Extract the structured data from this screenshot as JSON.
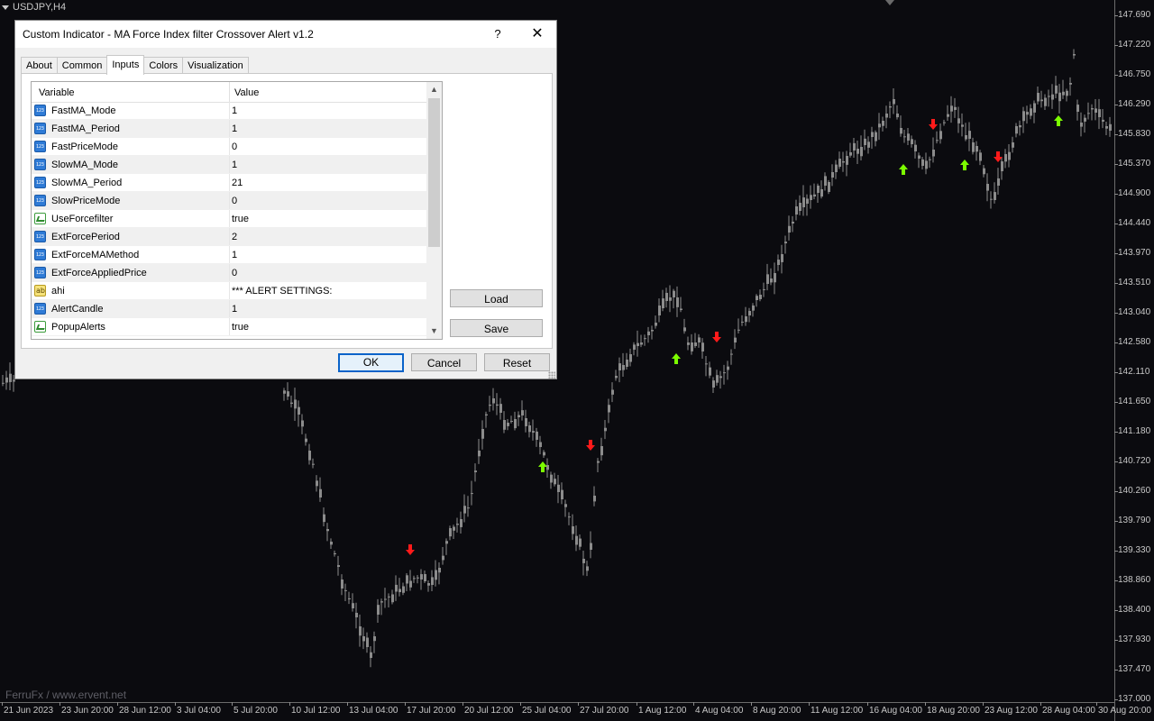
{
  "chart": {
    "symbol": "USDJPY,H4",
    "watermark": "FerruFx / www.ervent.net",
    "price_labels": [
      "147.690",
      "147.220",
      "146.750",
      "146.290",
      "145.830",
      "145.370",
      "144.900",
      "144.440",
      "143.970",
      "143.510",
      "143.040",
      "142.580",
      "142.110",
      "141.650",
      "141.180",
      "140.720",
      "140.260",
      "139.790",
      "139.330",
      "138.860",
      "138.400",
      "137.930",
      "137.470",
      "137.000"
    ],
    "time_labels": [
      "21 Jun 2023",
      "23 Jun 20:00",
      "28 Jun 12:00",
      "3 Jul 04:00",
      "5 Jul 20:00",
      "10 Jul 12:00",
      "13 Jul 04:00",
      "17 Jul 20:00",
      "20 Jul 12:00",
      "25 Jul 04:00",
      "27 Jul 20:00",
      "1 Aug 12:00",
      "4 Aug 04:00",
      "8 Aug 20:00",
      "11 Aug 12:00",
      "16 Aug 04:00",
      "18 Aug 20:00",
      "23 Aug 12:00",
      "28 Aug 04:00",
      "30 Aug 20:00"
    ],
    "colors": {
      "background": "#0b0b0f",
      "candle": "#8c8c8c",
      "buy_arrow": "#7cfc00",
      "sell_arrow": "#ff1a1a",
      "axis_text": "#c8c8c8"
    }
  },
  "dialog": {
    "title": "Custom Indicator - MA  Force Index filter Crossover Alert v1.2",
    "help_label": "?",
    "close_label": "✕",
    "tabs": [
      "About",
      "Common",
      "Inputs",
      "Colors",
      "Visualization"
    ],
    "active_tab": "Inputs",
    "grid": {
      "col_variable": "Variable",
      "col_value": "Value",
      "rows": [
        {
          "icon": "number-icon",
          "variable": "FastMA_Mode",
          "value": "1"
        },
        {
          "icon": "number-icon",
          "variable": "FastMA_Period",
          "value": "1"
        },
        {
          "icon": "number-icon",
          "variable": "FastPriceMode",
          "value": "0"
        },
        {
          "icon": "number-icon",
          "variable": "SlowMA_Mode",
          "value": "1"
        },
        {
          "icon": "number-icon",
          "variable": "SlowMA_Period",
          "value": "21"
        },
        {
          "icon": "number-icon",
          "variable": "SlowPriceMode",
          "value": "0"
        },
        {
          "icon": "boolean-icon",
          "variable": "UseForcefilter",
          "value": "true"
        },
        {
          "icon": "number-icon",
          "variable": "ExtForcePeriod",
          "value": "2"
        },
        {
          "icon": "number-icon",
          "variable": "ExtForceMAMethod",
          "value": "1"
        },
        {
          "icon": "number-icon",
          "variable": "ExtForceAppliedPrice",
          "value": "0"
        },
        {
          "icon": "string-icon",
          "variable": "ahi",
          "value": "*** ALERT SETTINGS:"
        },
        {
          "icon": "number-icon",
          "variable": "AlertCandle",
          "value": "1"
        },
        {
          "icon": "boolean-icon",
          "variable": "PopupAlerts",
          "value": "true"
        }
      ]
    },
    "load_label": "Load",
    "save_label": "Save",
    "ok_label": "OK",
    "cancel_label": "Cancel",
    "reset_label": "Reset"
  }
}
